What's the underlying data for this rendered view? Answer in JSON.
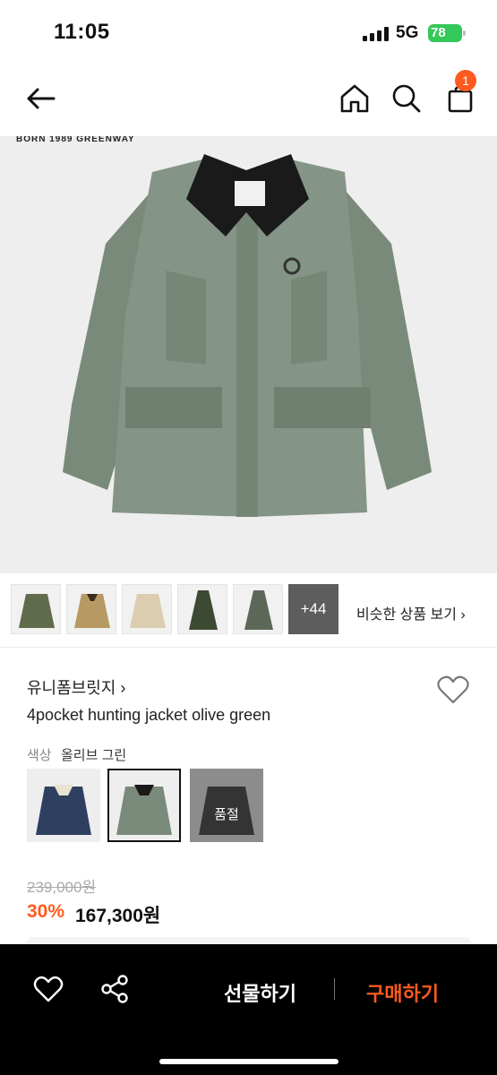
{
  "status": {
    "time": "11:05",
    "network": "5G",
    "battery": "78"
  },
  "nav": {
    "cart_count": "1"
  },
  "hero": {
    "tag": "BORN 1989 GREENWAY"
  },
  "thumbs": {
    "more_count": "+44",
    "similar_label": "비슷한 상품 보기 ›"
  },
  "product": {
    "brand": "유니폼브릿지 ›",
    "title": "4pocket hunting jacket olive green",
    "color_label": "색상",
    "color_value": "올리브 그린",
    "soldout_label": "품절"
  },
  "price": {
    "original": "239,000원",
    "discount": "30%",
    "sale": "167,300원"
  },
  "bottom": {
    "gift_label": "선물하기",
    "buy_label": "구매하기"
  },
  "colors": {
    "accent": "#ff5a1f",
    "olive": "#7a8a7a",
    "navy": "#2f3f5f",
    "black": "#000000"
  }
}
